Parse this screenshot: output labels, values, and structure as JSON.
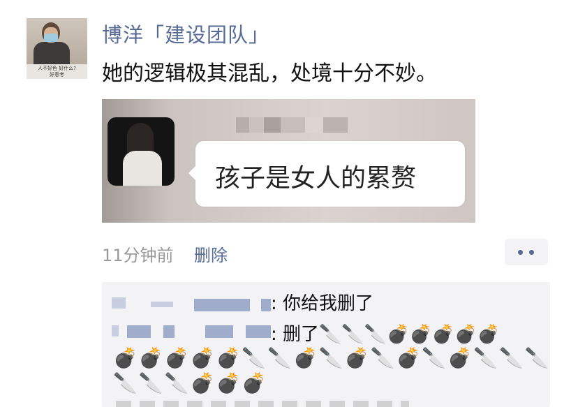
{
  "post": {
    "author_avatar_caption_line1": "人不好色 好什么?",
    "author_avatar_caption_line2": "好患考",
    "username": "博洋「建设团队」",
    "text": "她的逻辑极其混乱，处境十分不妙。",
    "image_bubble_text": "孩子是女人的累赘",
    "timestamp": "11分钟前",
    "delete_label": "删除"
  },
  "comments": [
    {
      "text": ": 你给我删了"
    },
    {
      "text": ": 删了🔪🔪🔪💣💣💣💣💣",
      "line2": "💣💣💣💣💣🔪🔪💣🔪💣🔪💣🔪💣🔪🔪🔪",
      "line3": "🔪🔪🔪💣💣💣"
    }
  ],
  "colors": {
    "link": "#576b95",
    "comment_bg": "#f3f3f5",
    "muted": "#9a9a9a"
  }
}
